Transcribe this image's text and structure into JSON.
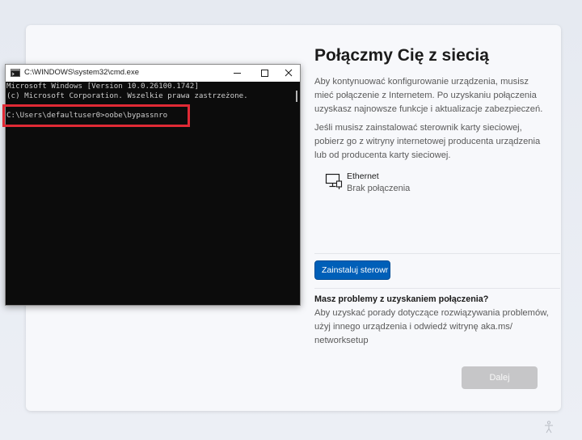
{
  "oobe": {
    "title": "Połączmy Cię z siecią",
    "paragraph1": "Aby kontynuować konfigurowanie urządzenia, musisz mieć połączenie z Internetem. Po uzyskaniu połączenia uzyskasz najnowsze funkcje i aktualizacje zabezpieczeń.",
    "paragraph2": "Jeśli musisz zainstalować sterownik karty sieciowej, pobierz go z witryny internetowej producenta urządzenia lub od producenta karty sieciowej.",
    "network": {
      "name": "Ethernet",
      "status": "Brak połączenia",
      "icon": "ethernet-monitor-icon"
    },
    "install_button": "Zainstaluj sterowr",
    "help_title": "Masz problemy z uzyskaniem połączenia?",
    "help_text": "Aby uzyskać porady dotyczące rozwiązywania problemów, użyj innego urządzenia i odwiedź witrynę aka.ms/ networksetup",
    "next_button": "Dalej"
  },
  "cmd": {
    "title": "C:\\WINDOWS\\system32\\cmd.exe",
    "lines": [
      "Microsoft Windows [Version 10.0.26100.1742]",
      "(c) Microsoft Corporation. Wszelkie prawa zastrzeżone.",
      "C:\\Users\\defaultuser0>oobe\\bypassnro"
    ]
  },
  "colors": {
    "accent": "#005fb8",
    "highlight": "#e02a35",
    "console_bg": "#0c0c0c",
    "console_text": "#cccccc"
  }
}
